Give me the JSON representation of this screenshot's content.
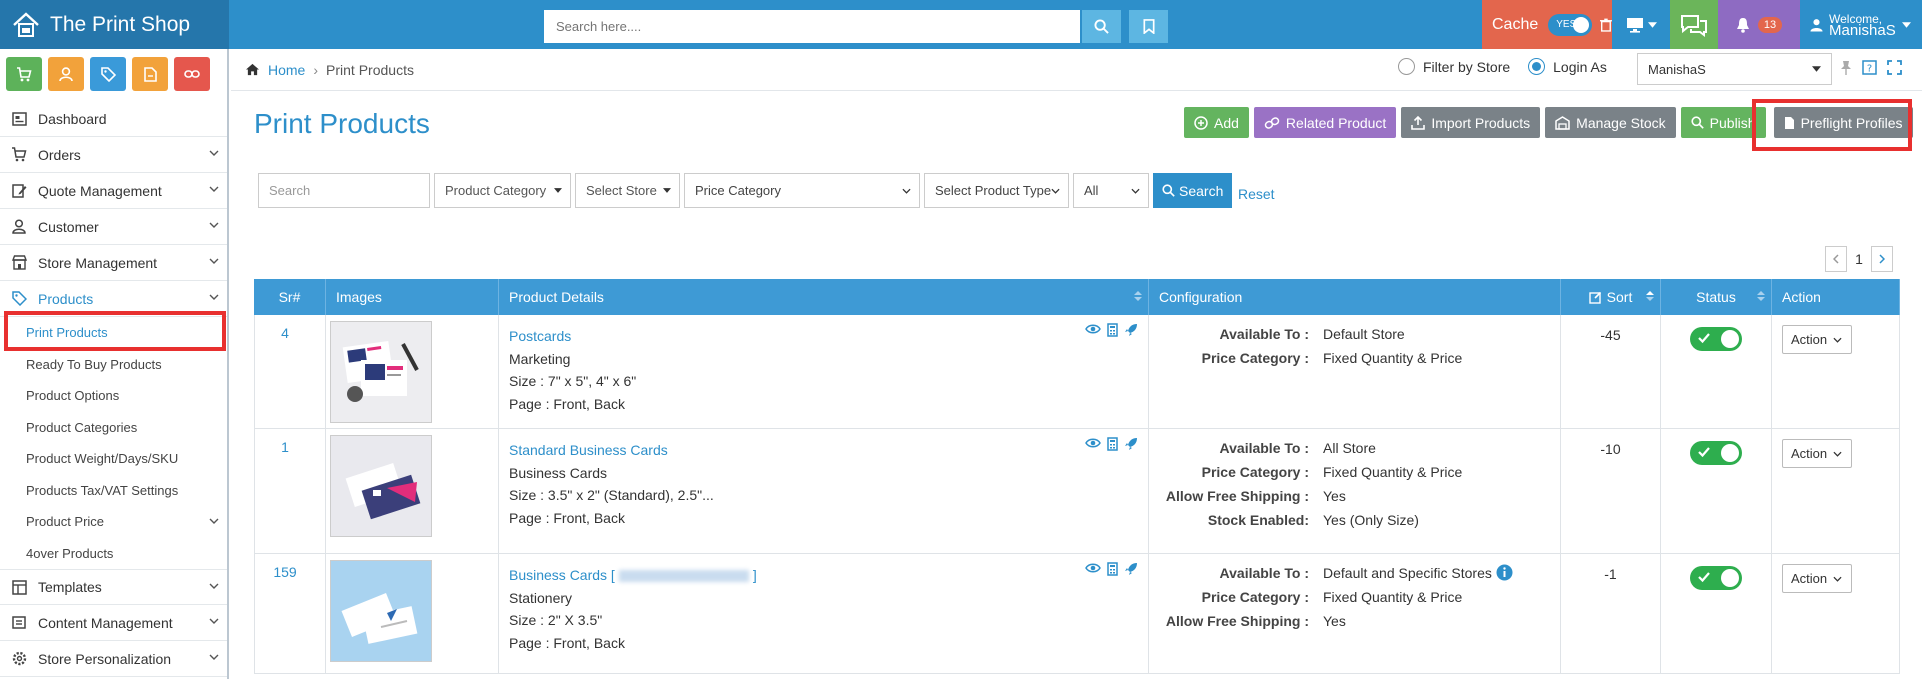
{
  "app": {
    "title": "The Print Shop"
  },
  "search": {
    "placeholder": "Search here...."
  },
  "cache": {
    "label": "Cache",
    "toggle": "YES"
  },
  "notifications": {
    "count": "13"
  },
  "user": {
    "welcome": "Welcome,",
    "name": "ManishaS"
  },
  "sidebar": {
    "items": [
      {
        "label": "Dashboard"
      },
      {
        "label": "Orders"
      },
      {
        "label": "Quote Management"
      },
      {
        "label": "Customer"
      },
      {
        "label": "Store Management"
      },
      {
        "label": "Products"
      }
    ],
    "sub": [
      {
        "label": "Print Products"
      },
      {
        "label": "Ready To Buy Products"
      },
      {
        "label": "Product Options"
      },
      {
        "label": "Product Categories"
      },
      {
        "label": "Product Weight/Days/SKU"
      },
      {
        "label": "Products Tax/VAT Settings"
      },
      {
        "label": "Product Price"
      },
      {
        "label": "4over Products"
      }
    ],
    "items2": [
      {
        "label": "Templates"
      },
      {
        "label": "Content Management"
      },
      {
        "label": "Store Personalization"
      }
    ]
  },
  "breadcrumb": {
    "home": "Home",
    "sep": "›",
    "current": "Print Products"
  },
  "filters": {
    "by_store": "Filter by Store",
    "login_as": "Login As",
    "login_value": "ManishaS"
  },
  "page": {
    "title": "Print Products"
  },
  "actions": {
    "add": "Add",
    "related": "Related Product",
    "import": "Import Products",
    "stock": "Manage Stock",
    "publish": "Publish",
    "preflight": "Preflight Profiles"
  },
  "filter_row": {
    "search_placeholder": "Search",
    "category": "Product Category",
    "store": "Select Store",
    "price": "Price Category",
    "type": "Select Product Type",
    "all": "All",
    "search_btn": "Search",
    "reset": "Reset"
  },
  "pager": {
    "page": "1"
  },
  "table": {
    "headers": [
      "Sr#",
      "Images",
      "Product Details",
      "Configuration",
      "Sort",
      "Status",
      "Action"
    ],
    "rows": [
      {
        "sr": "4",
        "name": "Postcards",
        "category": "Marketing",
        "size": "Size : 7\" x 5\", 4\" x 6\"",
        "pagei": "Page : Front, Back",
        "config": [
          {
            "k": "Available To :",
            "v": "Default Store"
          },
          {
            "k": "Price Category :",
            "v": "Fixed Quantity & Price"
          }
        ],
        "sort": "-45",
        "action": "Action"
      },
      {
        "sr": "1",
        "name": "Standard Business Cards",
        "category": "Business Cards",
        "size": "Size : 3.5\" x 2\" (Standard), 2.5\"...",
        "pagei": "Page : Front, Back",
        "config": [
          {
            "k": "Available To :",
            "v": "All Store"
          },
          {
            "k": "Price Category :",
            "v": "Fixed Quantity & Price"
          },
          {
            "k": "Allow Free Shipping :",
            "v": "Yes"
          },
          {
            "k": "Stock Enabled:",
            "v": "Yes (Only Size)"
          }
        ],
        "sort": "-10",
        "action": "Action"
      },
      {
        "sr": "159",
        "name": "Business Cards [",
        "name_end": "]",
        "category": "Stationery",
        "size": "Size : 2\" X 3.5\"",
        "pagei": "Page : Front, Back",
        "config": [
          {
            "k": "Available To :",
            "v": "Default and Specific Stores"
          },
          {
            "k": "Price Category :",
            "v": "Fixed Quantity & Price"
          },
          {
            "k": "Allow Free Shipping :",
            "v": "Yes"
          }
        ],
        "sort": "-1",
        "action": "Action"
      }
    ]
  }
}
